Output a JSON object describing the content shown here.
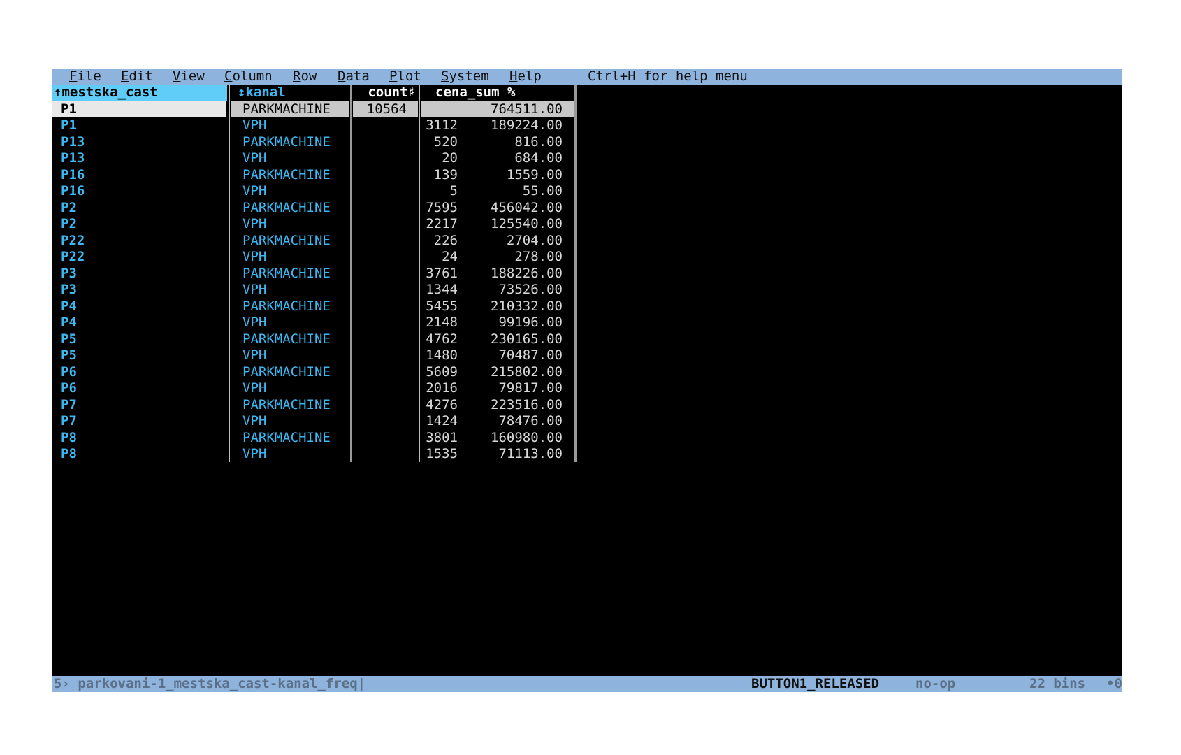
{
  "menu": {
    "items": [
      {
        "pre": "",
        "ul": "F",
        "post": "ile"
      },
      {
        "pre": "",
        "ul": "E",
        "post": "dit"
      },
      {
        "pre": "",
        "ul": "V",
        "post": "iew"
      },
      {
        "pre": "",
        "ul": "C",
        "post": "olumn"
      },
      {
        "pre": "",
        "ul": "R",
        "post": "ow"
      },
      {
        "pre": "",
        "ul": "D",
        "post": "ata"
      },
      {
        "pre": "",
        "ul": "P",
        "post": "lot"
      },
      {
        "pre": "",
        "ul": "S",
        "post": "ystem"
      },
      {
        "pre": "",
        "ul": "H",
        "post": "elp"
      }
    ],
    "help_hint": "Ctrl+H for help menu"
  },
  "table": {
    "columns": [
      "↑mestska_cast",
      "↕kanal",
      "count♯",
      "cena_sum %"
    ],
    "rows": [
      [
        "P1",
        "PARKMACHINE",
        "10564",
        "764511.00"
      ],
      [
        "P1",
        "VPH",
        "3112",
        "189224.00"
      ],
      [
        "P13",
        "PARKMACHINE",
        "520",
        "816.00"
      ],
      [
        "P13",
        "VPH",
        "20",
        "684.00"
      ],
      [
        "P16",
        "PARKMACHINE",
        "139",
        "1559.00"
      ],
      [
        "P16",
        "VPH",
        "5",
        "55.00"
      ],
      [
        "P2",
        "PARKMACHINE",
        "7595",
        "456042.00"
      ],
      [
        "P2",
        "VPH",
        "2217",
        "125540.00"
      ],
      [
        "P22",
        "PARKMACHINE",
        "226",
        "2704.00"
      ],
      [
        "P22",
        "VPH",
        "24",
        "278.00"
      ],
      [
        "P3",
        "PARKMACHINE",
        "3761",
        "188226.00"
      ],
      [
        "P3",
        "VPH",
        "1344",
        "73526.00"
      ],
      [
        "P4",
        "PARKMACHINE",
        "5455",
        "210332.00"
      ],
      [
        "P4",
        "VPH",
        "2148",
        "99196.00"
      ],
      [
        "P5",
        "PARKMACHINE",
        "4762",
        "230165.00"
      ],
      [
        "P5",
        "VPH",
        "1480",
        "70487.00"
      ],
      [
        "P6",
        "PARKMACHINE",
        "5609",
        "215802.00"
      ],
      [
        "P6",
        "VPH",
        "2016",
        "79817.00"
      ],
      [
        "P7",
        "PARKMACHINE",
        "4276",
        "223516.00"
      ],
      [
        "P7",
        "VPH",
        "1424",
        "78476.00"
      ],
      [
        "P8",
        "PARKMACHINE",
        "3801",
        "160980.00"
      ],
      [
        "P8",
        "VPH",
        "1535",
        "71113.00"
      ]
    ],
    "selected_row": 0
  },
  "status": {
    "sheet": "5› parkovani-1_mestska_cast-kanal_freq|",
    "last_event": "BUTTON1_RELEASED",
    "command": "no-op",
    "bins": "22 bins",
    "flag": "•0"
  }
}
